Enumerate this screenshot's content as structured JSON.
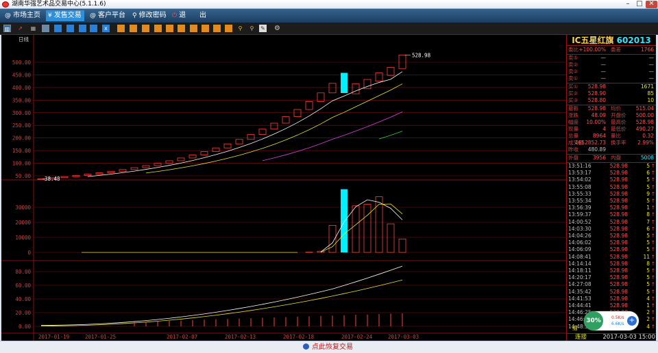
{
  "window": {
    "title": "湖南华强艺术品交易中心(5.1.1.6)",
    "min": "–",
    "max": "□",
    "close": "✕"
  },
  "menu": [
    {
      "label": "市场主页",
      "icon": "@"
    },
    {
      "label": "发售交易",
      "icon": "¥"
    },
    {
      "label": "客户平台",
      "icon": "@"
    },
    {
      "label": "修改密码",
      "icon": "⚲"
    },
    {
      "label": "退",
      "icon": "⏻"
    },
    {
      "label": "出",
      "icon": ""
    }
  ],
  "toolbar_icons": [
    "bar-chart-icon",
    "line-chart-icon",
    "calc-icon",
    "table-icon",
    "tool-icon",
    "tool-icon",
    "tool-icon",
    "x-icon",
    "tool-icon",
    "tool-icon",
    "tool-icon",
    "tool-icon",
    "tool-icon",
    "tool-icon",
    "tool-icon",
    "tool-icon",
    "tool-icon",
    "tool-icon",
    "tool-icon",
    "zoom-in-icon",
    "zoom-out-icon",
    "pen-icon",
    "gear-icon"
  ],
  "colors": {
    "up": "#ff4040",
    "down": "#00f0ff",
    "label": "#d04040",
    "text": "#c0c0c0",
    "yellow": "#e8e832",
    "cyan": "#00e6e6",
    "grid": "#8a0e0e"
  },
  "chart_data": {
    "type": "candlestick",
    "period_label": "日线",
    "price_axis": [
      "500.00",
      "450.00",
      "400.00",
      "350.00",
      "300.00",
      "250.00",
      "200.00",
      "150.00",
      "100.00",
      "50.00"
    ],
    "price_ylim": [
      50,
      535
    ],
    "high_annotation": "528.98",
    "low_annotation": "38.48",
    "dates_axis": [
      "2017-01-19",
      "2017-01-25",
      "2017-02-07",
      "2017-02-13",
      "2017-02-18",
      "2017-02-24",
      "2017-03-03"
    ],
    "candles": [
      [
        38.48,
        38.48
      ],
      [
        38.48,
        42.3
      ],
      [
        42.3,
        46.5
      ],
      [
        46.5,
        51.2
      ],
      [
        51.2,
        56.3
      ],
      [
        56.3,
        61.9
      ],
      [
        61.9,
        68.1
      ],
      [
        68.1,
        74.9
      ],
      [
        74.9,
        82.4
      ],
      [
        82.4,
        90.6
      ],
      [
        90.6,
        99.7
      ],
      [
        99.7,
        109.7
      ],
      [
        109.7,
        120.6
      ],
      [
        120.6,
        132.7
      ],
      [
        132.7,
        146.0
      ],
      [
        146.0,
        160.6
      ],
      [
        160.6,
        176.6
      ],
      [
        176.6,
        194.3
      ],
      [
        194.3,
        213.7
      ],
      [
        213.7,
        235.1
      ],
      [
        235.1,
        258.6
      ],
      [
        258.6,
        284.4
      ],
      [
        284.4,
        312.9
      ],
      [
        312.9,
        344.2
      ],
      [
        344.2,
        378.6
      ],
      [
        378.6,
        416.4
      ],
      [
        458.0,
        378.0
      ],
      [
        375.0,
        415.0
      ],
      [
        395.0,
        432.0
      ],
      [
        425.0,
        458.0
      ],
      [
        448.0,
        480.0
      ],
      [
        475.0,
        528.98
      ]
    ],
    "ma_price": [
      {
        "color": "#ffffff",
        "values": [
          null,
          null,
          null,
          null,
          null,
          null,
          null,
          null,
          null,
          null,
          null,
          null,
          null,
          null,
          null,
          null,
          null,
          null,
          null,
          null,
          null,
          null,
          null,
          null,
          null,
          null,
          null,
          null,
          null,
          null,
          null,
          null
        ]
      },
      {
        "color": "#e8e832",
        "values": []
      },
      {
        "color": "#e040e0",
        "values": []
      },
      {
        "color": "#3cd03c",
        "values": []
      }
    ],
    "volume_axis": [
      "30000",
      "20000",
      "10000",
      "0"
    ],
    "volume_ylim": [
      0,
      45000
    ],
    "volumes": [
      0,
      0,
      0,
      0,
      0,
      0,
      0,
      0,
      0,
      0,
      0,
      0,
      0,
      0,
      0,
      0,
      0,
      0,
      0,
      0,
      0,
      0,
      0,
      0,
      200,
      800,
      18000,
      42000,
      31000,
      32000,
      37000,
      19000,
      8964
    ],
    "volume_up": [
      false,
      false,
      false,
      false,
      false,
      false,
      false,
      false,
      false,
      false,
      false,
      false,
      false,
      false,
      false,
      false,
      false,
      false,
      false,
      false,
      false,
      false,
      false,
      false,
      true,
      true,
      false,
      true,
      true,
      true,
      true,
      true,
      true
    ],
    "indicator_axis": [
      "80.00",
      "60.00",
      "40.00",
      "20.00",
      "0.00"
    ],
    "indicator_ylim": [
      0,
      100
    ]
  },
  "panel": {
    "name": "IC五星红旗",
    "code": "602013",
    "ratio": {
      "l1": "委比",
      "v1": "+100.00%",
      "l2": "委差",
      "v2": "1766"
    },
    "asks": [
      {
        "l": "卖⑤",
        "p": "—",
        "v": "—"
      },
      {
        "l": "卖②",
        "p": "—",
        "v": "—"
      },
      {
        "l": "卖②",
        "p": "—",
        "v": "—"
      },
      {
        "l": "卖①",
        "p": "—",
        "v": "—"
      }
    ],
    "bids": [
      {
        "l": "买①",
        "p": "528.98",
        "v": "1671"
      },
      {
        "l": "买②",
        "p": "528.90",
        "v": "85"
      },
      {
        "l": "买③",
        "p": "528.80",
        "v": "10"
      }
    ],
    "stats": [
      {
        "l1": "最新",
        "v1": "528.98",
        "l2": "均价",
        "v2": "515.04"
      },
      {
        "l1": "涨跌",
        "v1": "48.09",
        "l2": "开盘价",
        "v2": "500.00"
      },
      {
        "l1": "幅度",
        "v1": "10.00%",
        "l2": "最高价",
        "v2": "528.98"
      },
      {
        "l1": "现量",
        "v1": "4",
        "l2": "最低价",
        "v2": "490.27"
      },
      {
        "l1": "总量",
        "v1": "8964",
        "l2": "量比",
        "v2": "0.32"
      },
      {
        "l1": "成交额",
        "v1": "4652852.73",
        "l2": "换手率",
        "v2": "2.99%"
      }
    ],
    "prev": {
      "l": "昨收",
      "v": "480.89"
    },
    "outer": {
      "l1": "外盘",
      "v1": "3956",
      "l2": "内盘",
      "v2": "5008"
    },
    "ticks": [
      {
        "t": "13:51:16",
        "p": "528.98",
        "v": "5"
      },
      {
        "t": "13:53:17",
        "p": "528.98",
        "v": "6"
      },
      {
        "t": "13:54:02",
        "p": "528.98",
        "v": "5"
      },
      {
        "t": "13:55:08",
        "p": "528.98",
        "v": "5"
      },
      {
        "t": "13:55:33",
        "p": "528.98",
        "v": "9"
      },
      {
        "t": "13:55:34",
        "p": "528.98",
        "v": "5"
      },
      {
        "t": "13:56:39",
        "p": "528.98",
        "v": "1"
      },
      {
        "t": "13:59:37",
        "p": "528.98",
        "v": "8"
      },
      {
        "t": "14:00:52",
        "p": "528.98",
        "v": "7"
      },
      {
        "t": "14:03:30",
        "p": "528.98",
        "v": "6"
      },
      {
        "t": "14:04:26",
        "p": "528.98",
        "v": "5"
      },
      {
        "t": "14:06:02",
        "p": "528.98",
        "v": "5"
      },
      {
        "t": "14:06:09",
        "p": "528.98",
        "v": "5"
      },
      {
        "t": "14:08:41",
        "p": "528.98",
        "v": "11"
      },
      {
        "t": "14:14:14",
        "p": "528.98",
        "v": "8"
      },
      {
        "t": "14:18:11",
        "p": "528.98",
        "v": "5"
      },
      {
        "t": "14:20:17",
        "p": "528.98",
        "v": "5"
      },
      {
        "t": "14:27:08",
        "p": "528.98",
        "v": "5"
      },
      {
        "t": "14:35:42",
        "p": "528.98",
        "v": "5"
      },
      {
        "t": "14:41:53",
        "p": "528.98",
        "v": "4"
      },
      {
        "t": "14:44:41",
        "p": "528.98",
        "v": "1"
      },
      {
        "t": "14:46:25",
        "p": "528.98",
        "v": "2"
      },
      {
        "t": "14:46:43",
        "p": "528.98",
        "v": "2"
      },
      {
        "t": "14:48:53",
        "p": "528.98",
        "v": "4"
      }
    ],
    "bottom_tab": "细",
    "conn": "连接",
    "datetime": "2017-03-03 15:00"
  },
  "net": {
    "percent": "30%",
    "up": "0.5K/s",
    "down": "6.6K/s",
    "plus": "+"
  },
  "status": {
    "restore": "点此恢复交易"
  }
}
